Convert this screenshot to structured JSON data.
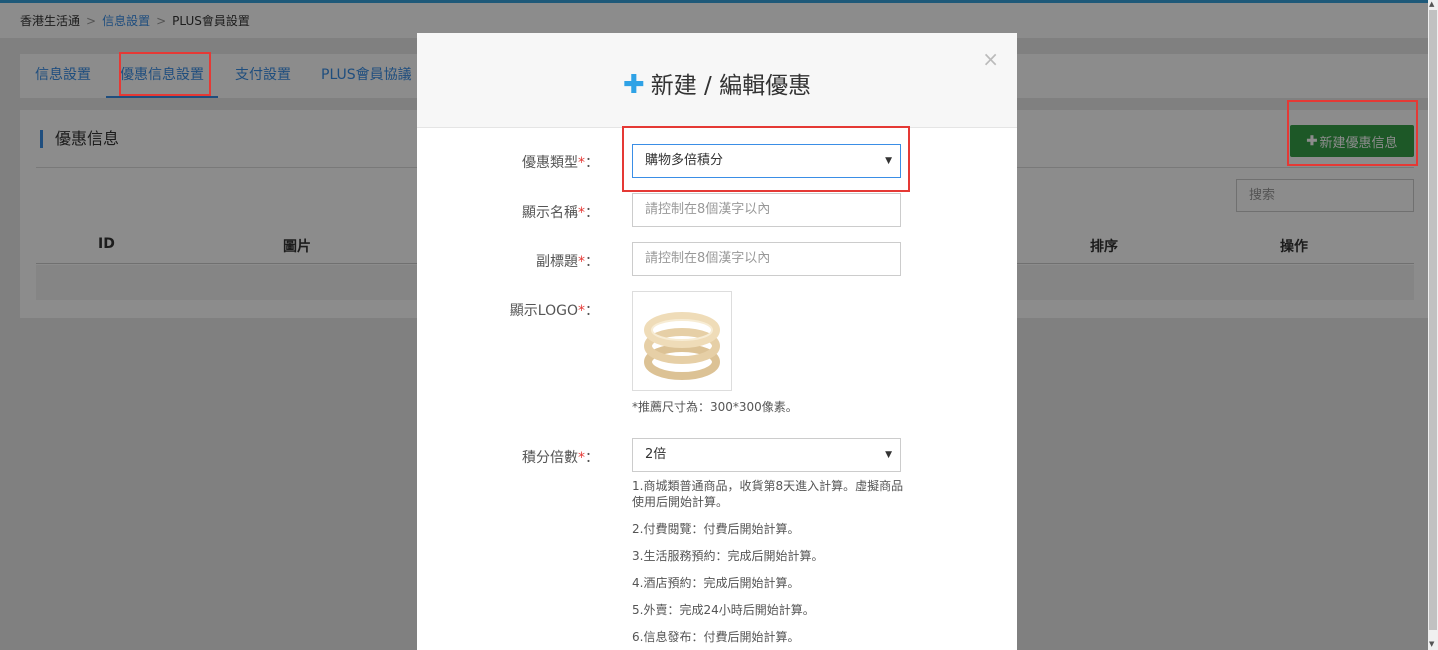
{
  "breadcrumb": {
    "root": "香港生活通",
    "level2": "信息設置",
    "current": "PLUS會員設置",
    "sep": ">"
  },
  "tabs": [
    {
      "label": "信息設置"
    },
    {
      "label": "優惠信息設置"
    },
    {
      "label": "支付設置"
    },
    {
      "label": "PLUS會員協議"
    }
  ],
  "section": {
    "title": "優惠信息",
    "new_button": "新建優惠信息",
    "search_placeholder": "搜索"
  },
  "table": {
    "headers": [
      "ID",
      "圖片",
      "排序",
      "操作"
    ]
  },
  "modal": {
    "title": "新建 / 編輯優惠",
    "close": "×",
    "fields": {
      "type": {
        "label": "優惠類型",
        "value": "購物多倍積分"
      },
      "name": {
        "label": "顯示名稱",
        "placeholder": "請控制在8個漢字以內"
      },
      "subtitle": {
        "label": "副標題",
        "placeholder": "請控制在8個漢字以內"
      },
      "logo": {
        "label": "顯示LOGO",
        "hint": "*推薦尺寸為：300*300像素。"
      },
      "multiplier": {
        "label": "積分倍數",
        "value": "2倍"
      }
    },
    "notes": [
      "1.商城類普通商品，收貨第8天進入計算。虛擬商品使用后開始計算。",
      "2.付費閱覽：付費后開始計算。",
      "3.生活服務預約：完成后開始計算。",
      "4.酒店預約：完成后開始計算。",
      "5.外賣：完成24小時后開始計算。",
      "6.信息發布：付費后開始計算。"
    ],
    "required_mark": "*",
    "colon": "："
  },
  "colors": {
    "accent": "#3a8ee6",
    "primary_green": "#35a047",
    "highlight_red": "#e53935",
    "plus_blue": "#2fa2e6"
  }
}
